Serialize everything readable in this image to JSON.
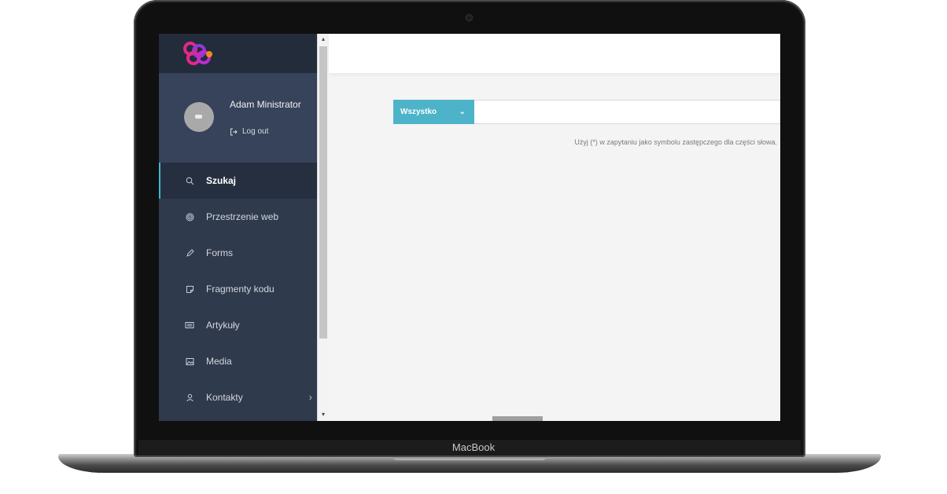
{
  "device": {
    "brand": "MacBook"
  },
  "sidebar": {
    "user": {
      "name": "Adam Ministrator",
      "logout_label": "Log out"
    },
    "menu": [
      {
        "label": "Szukaj",
        "icon": "search-icon",
        "active": true
      },
      {
        "label": "Przestrzenie web",
        "icon": "target-icon"
      },
      {
        "label": "Forms",
        "icon": "pencil-icon"
      },
      {
        "label": "Fragmenty kodu",
        "icon": "note-icon"
      },
      {
        "label": "Artykuły",
        "icon": "newspaper-icon"
      },
      {
        "label": "Media",
        "icon": "image-icon"
      },
      {
        "label": "Kontakty",
        "icon": "user-icon",
        "has_children": true
      }
    ]
  },
  "search": {
    "filter_label": "Wszystko",
    "query_value": "",
    "hint": "Użyj (*) w zapytaniu jako symbolu zastępczego dla części słowa."
  },
  "colors": {
    "accent": "#4db3c9",
    "sidebar_bg": "#2f3a4d",
    "logo_bar_bg": "#232c3b",
    "profile_bg": "#36435a",
    "main_bg": "#f4f4f4",
    "logo_pink": "#e2288a",
    "logo_purple": "#8e3bd6",
    "logo_orange": "#f08a1c"
  }
}
